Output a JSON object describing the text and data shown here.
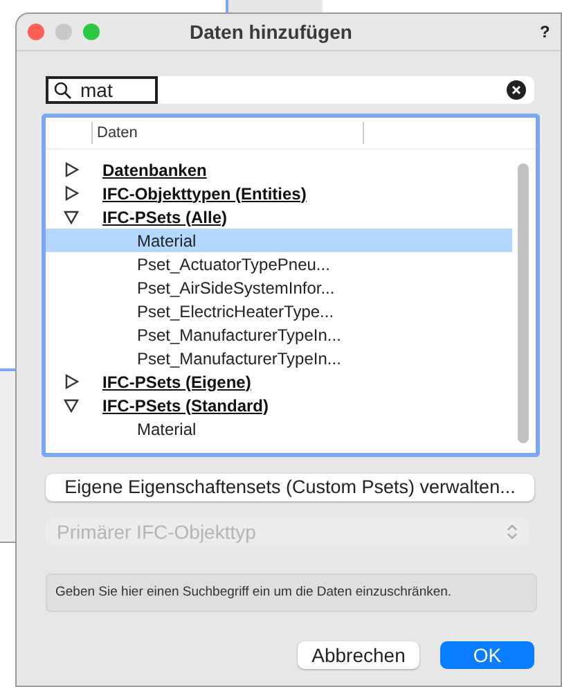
{
  "window": {
    "title": "Daten hinzufügen",
    "help": "?"
  },
  "search": {
    "value": "mat"
  },
  "tree": {
    "column": "Daten",
    "items": [
      {
        "label": "Datenbanken",
        "expanded": false,
        "selected": false
      },
      {
        "label": "IFC-Objekttypen (Entities)",
        "expanded": false,
        "selected": false
      },
      {
        "label": "IFC-PSets (Alle)",
        "expanded": true,
        "selected": false,
        "children": [
          {
            "label": "Material",
            "selected": true
          },
          {
            "label": "Pset_ActuatorTypePneu...",
            "selected": false
          },
          {
            "label": "Pset_AirSideSystemInfor...",
            "selected": false
          },
          {
            "label": "Pset_ElectricHeaterType...",
            "selected": false
          },
          {
            "label": "Pset_ManufacturerTypeIn...",
            "selected": false
          },
          {
            "label": "Pset_ManufacturerTypeIn...",
            "selected": false
          }
        ]
      },
      {
        "label": "IFC-PSets (Eigene)",
        "expanded": false,
        "selected": false
      },
      {
        "label": "IFC-PSets (Standard)",
        "expanded": true,
        "selected": false,
        "children": [
          {
            "label": "Material",
            "selected": false
          }
        ]
      }
    ]
  },
  "manage_button": "Eigene Eigenschaftensets (Custom Psets) verwalten...",
  "type_popup": {
    "value": "Primärer IFC-Objekttyp",
    "disabled": true
  },
  "hint": "Geben Sie hier einen Suchbegriff ein um die Daten einzuschränken.",
  "buttons": [
    {
      "label": "Abbrechen",
      "default": false
    },
    {
      "label": "OK",
      "default": true
    }
  ]
}
